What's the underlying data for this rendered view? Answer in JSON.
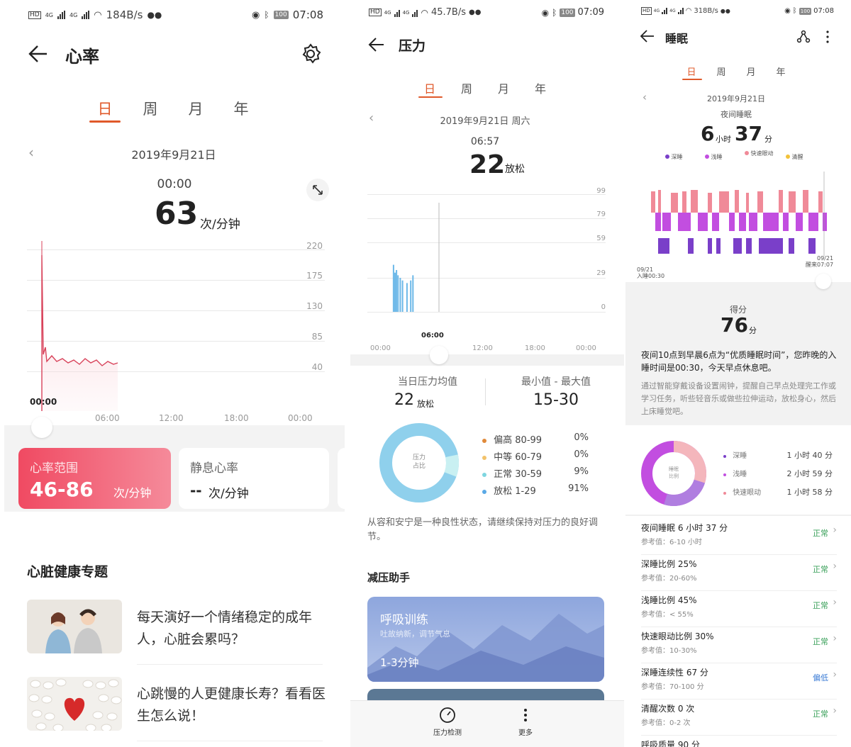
{
  "heart": {
    "status": {
      "speed": "184B/s",
      "battery": "100",
      "time": "07:08",
      "net1": "4G",
      "net2": "4G"
    },
    "title": "心率",
    "tabs": [
      "日",
      "周",
      "月",
      "年"
    ],
    "date": "2019年9月21日",
    "reading_time": "00:00",
    "reading_value": "63",
    "reading_unit": "次/分钟",
    "y_ticks": [
      "220",
      "175",
      "130",
      "85",
      "40"
    ],
    "x_ticks": [
      "06:00",
      "12:00",
      "18:00",
      "00:00"
    ],
    "cursor_label": "00:00",
    "range_card": {
      "label": "心率范围",
      "value": "46-86",
      "unit": "次/分钟"
    },
    "rest_card": {
      "label": "静息心率",
      "value": "--",
      "unit": "次/分钟"
    },
    "section_title": "心脏健康专题",
    "articles": [
      {
        "title": "每天演好一个情绪稳定的成年人，心脏会累吗？"
      },
      {
        "title": "心跳慢的人更健康长寿？看看医生怎么说！"
      }
    ],
    "colors": {
      "accent": "#e0592a",
      "card_red": "#f04a62"
    }
  },
  "stress": {
    "status": {
      "speed": "45.7B/s",
      "battery": "100",
      "time": "07:09",
      "net1": "4G",
      "net2": "4G"
    },
    "title": "压力",
    "tabs": [
      "日",
      "周",
      "月",
      "年"
    ],
    "date": "2019年9月21日 周六",
    "reading_time": "06:57",
    "reading_value": "22",
    "reading_unit": "放松",
    "y_ticks": [
      "99",
      "79",
      "59",
      "29",
      "0"
    ],
    "cursor_label": "06:00",
    "x_ticks": [
      "00:00",
      "06:00",
      "12:00",
      "18:00",
      "00:00"
    ],
    "avg_label": "当日压力均值",
    "avg_value": "22",
    "avg_unit": "放松",
    "minmax_label": "最小值 - 最大值",
    "minmax_value": "15-30",
    "donut_center": [
      "压力",
      "占比"
    ],
    "legend": [
      {
        "name": "偏高 80-99",
        "pct": "0%",
        "color": "#e08a3a"
      },
      {
        "name": "中等 60-79",
        "pct": "0%",
        "color": "#f2c26a"
      },
      {
        "name": "正常 30-59",
        "pct": "9%",
        "color": "#7fd6e0"
      },
      {
        "name": "放松 1-29",
        "pct": "91%",
        "color": "#5aa9e6"
      }
    ],
    "tip": "从容和安宁是一种良性状态，请继续保持对压力的良好调节。",
    "section_title": "减压助手",
    "breath_card": {
      "title": "呼吸训练",
      "subtitle": "吐故纳新，调节气息",
      "duration": "1-3分钟"
    },
    "bottom_nav": [
      {
        "label": "压力检测",
        "icon": "gauge-icon"
      },
      {
        "label": "更多",
        "icon": "more-vertical-icon"
      }
    ],
    "series": {
      "name": "stress",
      "points": [
        {
          "t": "02:50",
          "v": 18
        },
        {
          "t": "03:00",
          "v": 15
        },
        {
          "t": "03:10",
          "v": 16
        },
        {
          "t": "03:20",
          "v": 14
        },
        {
          "t": "03:35",
          "v": 13
        },
        {
          "t": "03:50",
          "v": 12
        },
        {
          "t": "04:20",
          "v": 11
        },
        {
          "t": "04:45",
          "v": 12
        },
        {
          "t": "05:00",
          "v": 14
        }
      ]
    }
  },
  "sleep": {
    "status": {
      "speed": "318B/s",
      "battery": "100",
      "time": "07:08",
      "net1": "4G",
      "net2": "4G"
    },
    "title": "睡眠",
    "tabs": [
      "日",
      "周",
      "月",
      "年"
    ],
    "date": "2019年9月21日",
    "subtitle": "夜间睡眠",
    "hours": "6",
    "hours_unit": "小时",
    "minutes": "37",
    "minutes_unit": "分",
    "stage_legend": [
      {
        "name": "深睡",
        "color": "#7a3fc9"
      },
      {
        "name": "浅睡",
        "color": "#c24ee0"
      },
      {
        "name": "快速眼动",
        "color": "#f08a98"
      },
      {
        "name": "清醒",
        "color": "#f2c23a"
      }
    ],
    "start_label": [
      "09/21",
      "入睡00:30"
    ],
    "end_label": [
      "09/21",
      "醒来07:07"
    ],
    "score_label": "得分",
    "score_value": "76",
    "score_unit": "分",
    "advice_main": "夜间10点到早晨6点为“优质睡眠时间”，您昨晚的入睡时间是00:30，今天早点休息吧。",
    "advice_sub": "通过智能穿戴设备设置闹钟，提醒自己早点处理完工作或学习任务，听些轻音乐或做些拉伸运动，放松身心，然后上床睡觉吧。",
    "donut_center": [
      "睡眠",
      "比例"
    ],
    "ratio_legend": [
      {
        "name": "深睡",
        "value": "1 小时 40 分",
        "color": "#7a3fc9"
      },
      {
        "name": "浅睡",
        "value": "2 小时 59 分",
        "color": "#c24ee0"
      },
      {
        "name": "快速眼动",
        "value": "1 小时 58 分",
        "color": "#f08a98"
      }
    ],
    "metrics": [
      {
        "title": "夜间睡眠  6 小时 37 分",
        "ref": "参考值：6-10 小时",
        "status": "正常",
        "level": "normal"
      },
      {
        "title": "深睡比例  25%",
        "ref": "参考值：20-60%",
        "status": "正常",
        "level": "normal"
      },
      {
        "title": "浅睡比例  45%",
        "ref": "参考值：< 55%",
        "status": "正常",
        "level": "normal"
      },
      {
        "title": "快速眼动比例  30%",
        "ref": "参考值：10-30%",
        "status": "正常",
        "level": "normal"
      },
      {
        "title": "深睡连续性  67 分",
        "ref": "参考值：70-100 分",
        "status": "偏低",
        "level": "low"
      },
      {
        "title": "清醒次数  0 次",
        "ref": "参考值：0-2 次",
        "status": "正常",
        "level": "normal"
      }
    ],
    "cutoff": "呼吸质量  90 分"
  }
}
